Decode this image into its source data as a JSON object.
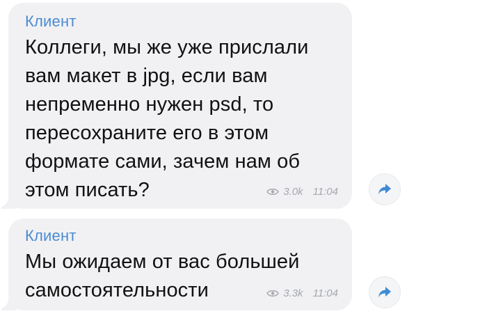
{
  "messages": [
    {
      "sender": "Клиент",
      "lines": [
        "Коллеги, мы же уже прислали",
        "вам макет в jpg, если вам",
        "непременно нужен psd, то",
        "пересохраните его в этом",
        "формате сами, зачем нам об",
        "этом писать?"
      ],
      "views": "3.0k",
      "time": "11:04"
    },
    {
      "sender": "Клиент",
      "lines": [
        "Мы ожидаем от вас большей",
        "самостоятельности"
      ],
      "views": "3.3k",
      "time": "11:04"
    }
  ],
  "icons": {
    "views": "eye-icon",
    "share": "share-arrow-icon"
  },
  "colors": {
    "bubble": "#f1f1f4",
    "sender": "#4b8bd1",
    "text": "#111111",
    "meta": "#a4a7ad",
    "share_arrow": "#3e8ad6"
  }
}
